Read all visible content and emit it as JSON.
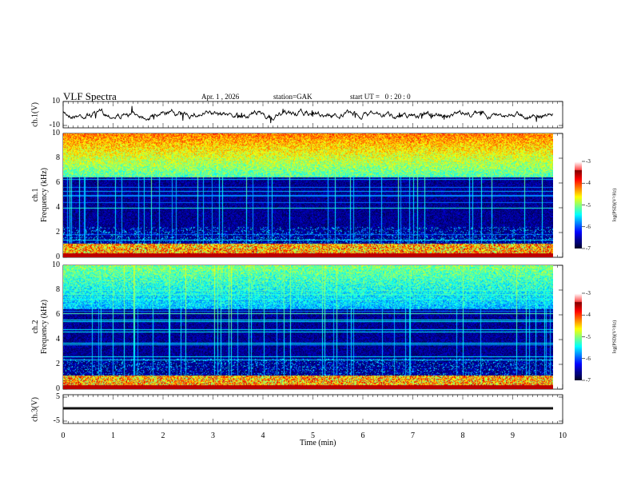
{
  "header": {
    "title": "VLF Spectra",
    "date": "Apr. 1 , 2026",
    "station": "station=GAK",
    "start_ut": "start UT =   0 : 20 : 0"
  },
  "chart_data": [
    {
      "type": "line",
      "panel": "ch1-waveform",
      "ylabel": "ch.1(V)",
      "ylim": [
        -10,
        10
      ],
      "yticks": [
        "10",
        "-10"
      ],
      "xlim": [
        0,
        10
      ]
    },
    {
      "type": "heatmap",
      "panel": "ch1-spectrogram",
      "ylabel_line1": "ch.1",
      "ylabel_line2": "Frequency  (kHz)",
      "ylim": [
        0,
        10
      ],
      "yticks": [
        "0",
        "2",
        "4",
        "6",
        "8",
        "10"
      ],
      "xlim": [
        0,
        10
      ],
      "colorbar": {
        "label": "log(PSD)(V²/Hz)",
        "range": [
          -7,
          -3
        ],
        "ticks": [
          "-3",
          "-4",
          "-5",
          "-6",
          "-7"
        ],
        "colormap": "jet-with-black-low-white-high"
      }
    },
    {
      "type": "heatmap",
      "panel": "ch2-spectrogram",
      "ylabel_line1": "ch.2",
      "ylabel_line2": "Frequency  (kHz)",
      "ylim": [
        0,
        10
      ],
      "yticks": [
        "0",
        "2",
        "4",
        "6",
        "8",
        "10"
      ],
      "xlim": [
        0,
        10
      ],
      "colorbar": {
        "label": "log(PSD)(V²/Hz)",
        "range": [
          -7,
          -3
        ],
        "ticks": [
          "-3",
          "-4",
          "-5",
          "-6",
          "-7"
        ],
        "colormap": "jet-with-black-low-white-high"
      }
    },
    {
      "type": "line",
      "panel": "ch3-waveform",
      "ylabel": "ch.3(V)",
      "ylim": [
        -5,
        5
      ],
      "yticks": [
        "5",
        "-5"
      ],
      "approx_value": -1.5,
      "xlim": [
        0,
        10
      ]
    }
  ],
  "xaxis": {
    "label": "Time  (min)",
    "ticks": [
      "0",
      "1",
      "2",
      "3",
      "4",
      "5",
      "6",
      "7",
      "8",
      "9",
      "10"
    ]
  }
}
